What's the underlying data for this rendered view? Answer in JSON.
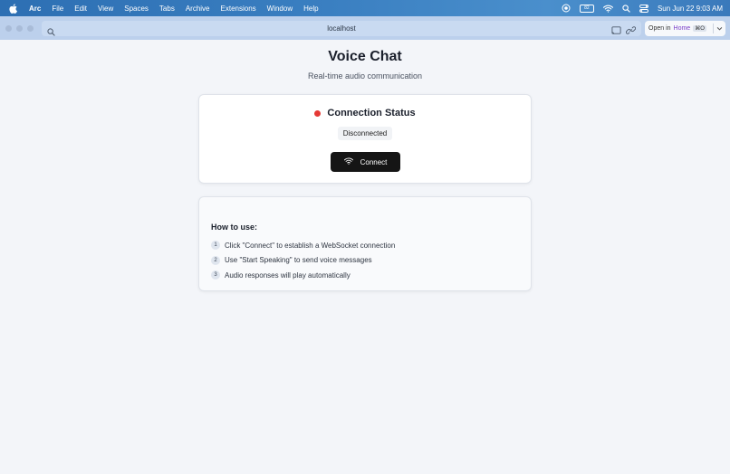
{
  "menubar": {
    "app": "Arc",
    "items": [
      "File",
      "Edit",
      "View",
      "Spaces",
      "Tabs",
      "Archive",
      "Extensions",
      "Window",
      "Help"
    ],
    "battery_label": "82",
    "clock": "Sun Jun 22  9:03 AM"
  },
  "browser": {
    "url": "localhost",
    "open_in_prefix": "Open in",
    "open_in_target": "Home",
    "open_in_shortcut": "⌘O"
  },
  "page": {
    "title": "Voice Chat",
    "subtitle": "Real-time audio communication",
    "status": {
      "heading": "Connection Status",
      "state": "Disconnected",
      "dot_color": "#e53935"
    },
    "connect_button": "Connect",
    "howto": {
      "title": "How to use:",
      "steps": [
        {
          "num": "1",
          "text": "Click \"Connect\" to establish a WebSocket connection"
        },
        {
          "num": "2",
          "text": "Use \"Start Speaking\" to send voice messages"
        },
        {
          "num": "3",
          "text": "Audio responses will play automatically"
        }
      ]
    }
  }
}
